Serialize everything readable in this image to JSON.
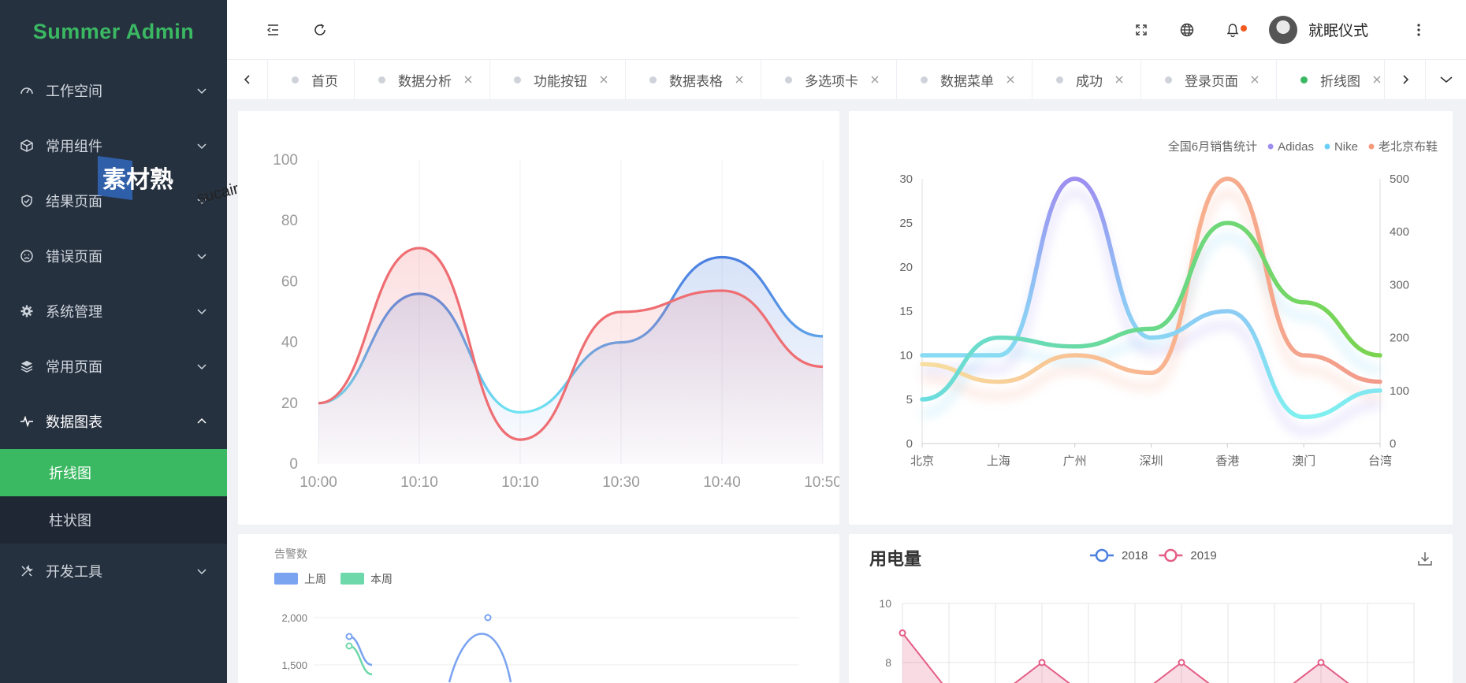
{
  "app": {
    "title": "Summer Admin"
  },
  "sidebar": {
    "items": [
      {
        "label": "工作空间",
        "icon": "dashboard-icon"
      },
      {
        "label": "常用组件",
        "icon": "cube-icon"
      },
      {
        "label": "结果页面",
        "icon": "shield-check-icon"
      },
      {
        "label": "错误页面",
        "icon": "sad-face-icon"
      },
      {
        "label": "系统管理",
        "icon": "gear-icon"
      },
      {
        "label": "常用页面",
        "icon": "layers-icon"
      },
      {
        "label": "数据图表",
        "icon": "pulse-icon",
        "expanded": true,
        "children": [
          {
            "label": "折线图",
            "active": true
          },
          {
            "label": "柱状图"
          }
        ]
      },
      {
        "label": "开发工具",
        "icon": "tools-icon"
      }
    ]
  },
  "watermark": {
    "brand": "素材熟",
    "url": "sucaire.com"
  },
  "header": {
    "user_name": "就眠仪式"
  },
  "tabs": [
    {
      "label": "首页",
      "closable": false
    },
    {
      "label": "数据分析",
      "closable": true
    },
    {
      "label": "功能按钮",
      "closable": true
    },
    {
      "label": "数据表格",
      "closable": true
    },
    {
      "label": "多选项卡",
      "closable": true
    },
    {
      "label": "数据菜单",
      "closable": true
    },
    {
      "label": "成功",
      "closable": true
    },
    {
      "label": "登录页面",
      "closable": true
    },
    {
      "label": "折线图",
      "closable": true,
      "active": true
    }
  ],
  "colors": {
    "brand": "#3bb862",
    "sidebar_bg": "#263140",
    "notify": "#f2581e"
  },
  "chart_data": [
    {
      "type": "area",
      "categories": [
        "10:00",
        "10:10",
        "10:10",
        "10:30",
        "10:40",
        "10:50"
      ],
      "ylim": [
        0,
        100
      ],
      "yticks": [
        "0",
        "20",
        "40",
        "60",
        "80",
        "100"
      ],
      "grid": "vertical",
      "series": [
        {
          "values": [
            20,
            56,
            17,
            40,
            68,
            42
          ],
          "color": "#4a7fe0"
        },
        {
          "values": [
            20,
            71,
            8,
            50,
            57,
            32
          ],
          "color": "#ee6e73"
        }
      ]
    },
    {
      "type": "line",
      "categories": [
        "北京",
        "上海",
        "广州",
        "深圳",
        "香港",
        "澳门",
        "台湾"
      ],
      "legend_title": "全国6月销售统计",
      "legend_position": "top-right",
      "y_left": {
        "ylim": [
          0,
          30
        ],
        "ticks": [
          "0",
          "5",
          "10",
          "15",
          "20",
          "25",
          "30"
        ]
      },
      "y_right": {
        "ylim": [
          0,
          500
        ],
        "ticks": [
          "0",
          "100",
          "200",
          "300",
          "400",
          "500"
        ]
      },
      "series": [
        {
          "name": "Adidas",
          "values": [
            10,
            10,
            30,
            12,
            15,
            3,
            6
          ],
          "color": "#9d8ef0"
        },
        {
          "name": "Nike",
          "values": [
            5,
            12,
            11,
            13,
            25,
            16,
            10
          ],
          "color": "#6ccff6"
        },
        {
          "name": "老北京布鞋",
          "values": [
            9,
            7,
            10,
            8,
            30,
            10,
            7
          ],
          "color": "#f79a7b"
        }
      ]
    },
    {
      "type": "line",
      "title": "告警数",
      "legend": [
        "上周",
        "本周"
      ],
      "legend_colors": [
        "#7aa3f0",
        "#6dd8a9"
      ],
      "yticks_visible": [
        "2,000",
        "1,500"
      ],
      "series": [
        {
          "name": "上周",
          "values": [
            1800,
            1500,
            2000,
            1400
          ]
        },
        {
          "name": "本周",
          "values": [
            1700,
            1400
          ]
        }
      ]
    },
    {
      "type": "area",
      "title": "用电量",
      "legend": [
        "2018",
        "2019"
      ],
      "legend_colors": [
        "#4a7fe0",
        "#e35d85"
      ],
      "yticks_visible": [
        "10",
        "8"
      ],
      "series": [
        {
          "name": "2019",
          "values": [
            9,
            7,
            6.8,
            8,
            6.8,
            6.8,
            8,
            6.8,
            6.8,
            8,
            6.8
          ]
        }
      ]
    }
  ]
}
